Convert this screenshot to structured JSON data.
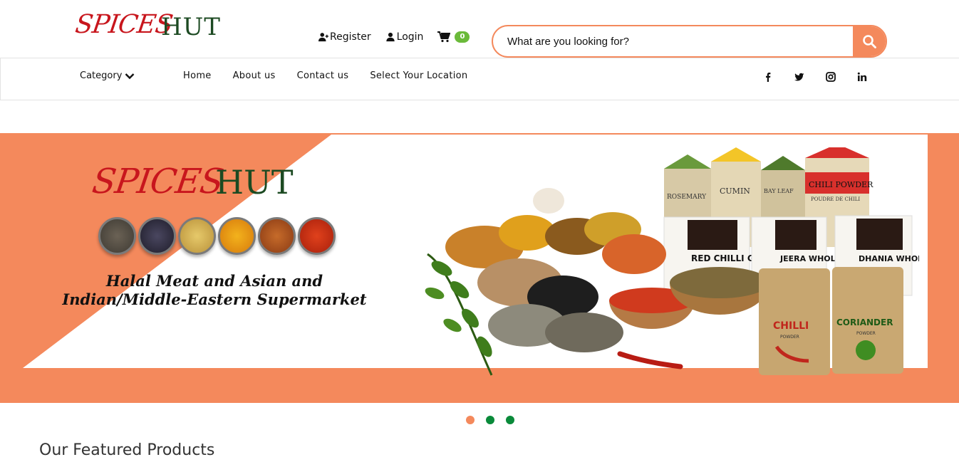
{
  "header": {
    "logo_spices": "SPICES",
    "logo_hut": "HUT",
    "register_label": "Register",
    "login_label": "Login",
    "cart_count": "0",
    "search_placeholder": "What are you looking for?"
  },
  "nav": {
    "category_label": "Category",
    "links": [
      "Home",
      "About us",
      "Contact us",
      "Select Your Location"
    ],
    "socials": [
      "facebook-icon",
      "twitter-icon",
      "instagram-icon",
      "linkedin-icon"
    ]
  },
  "banner": {
    "logo_spices": "SPICES",
    "logo_hut": "HUT",
    "tagline_line1": "Halal Meat and Asian and",
    "tagline_line2": "Indian/Middle-Eastern Supermarket",
    "packets": [
      "ROSEMARY",
      "CUMIN",
      "BAY LEAF",
      "CHILI POWDER",
      "RED CHILLI GROUND",
      "JEERA WHOLE",
      "DHANIA WHOLE",
      "CHILLI",
      "CORIANDER"
    ],
    "powder": "POWDER",
    "poudre": "POUDRE DE CHILI"
  },
  "carousel": {
    "slides": 3,
    "active": 0
  },
  "featured_title": "Our Featured Products",
  "colors": {
    "accent": "#f4895c",
    "green": "#0a8a3a",
    "brand_red": "#c8161d",
    "brand_green": "#1c4a22"
  }
}
